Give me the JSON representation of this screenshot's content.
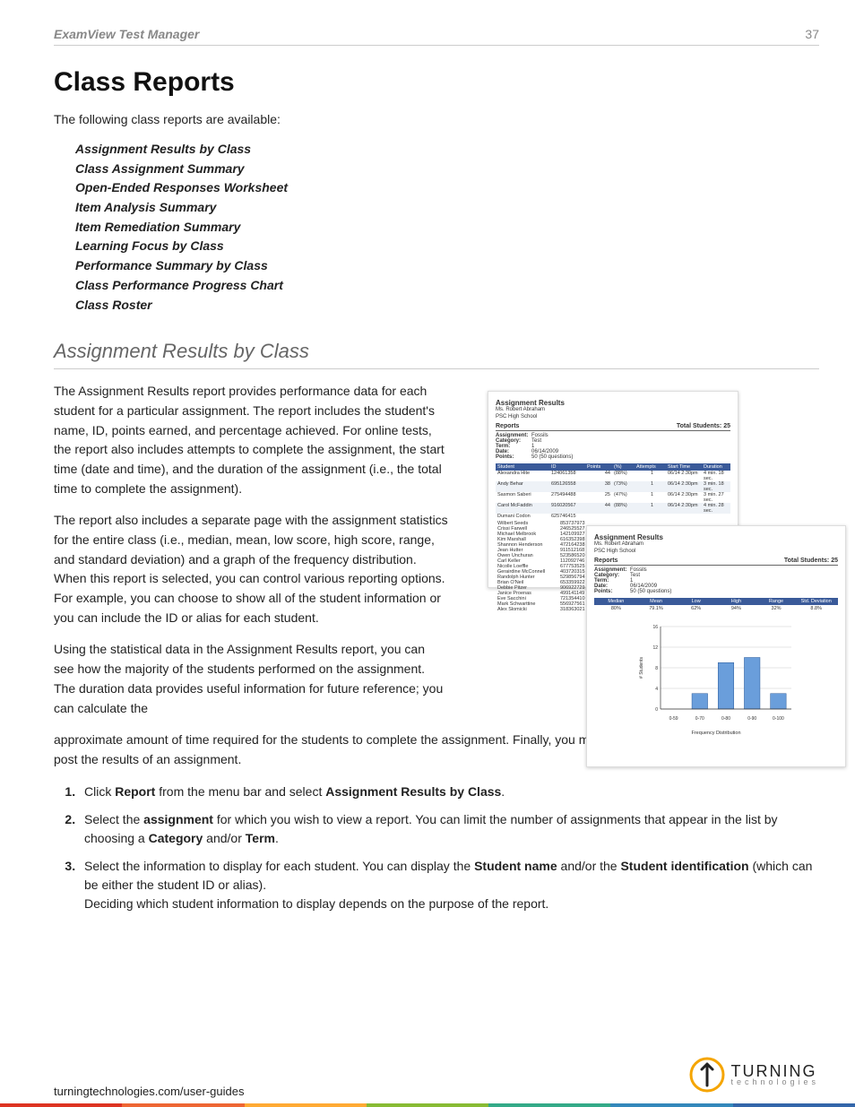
{
  "header": {
    "title": "ExamView Test Manager",
    "page_number": "37"
  },
  "main_title": "Class Reports",
  "intro": "The following class reports are available:",
  "reports": [
    "Assignment Results by Class",
    "Class Assignment Summary",
    "Open-Ended Responses Worksheet",
    "Item Analysis Summary",
    "Item Remediation Summary",
    "Learning Focus by Class",
    "Performance Summary by Class",
    "Class Performance Progress Chart",
    "Class Roster"
  ],
  "section_title": "Assignment Results by Class",
  "p1": "The Assignment Results report provides performance data for each student for a particular assignment. The report includes the student's name, ID, points earned, and percentage achieved. For online tests, the report also includes attempts to complete the assignment, the start time (date and time), and the duration of the assignment (i.e., the total time to complete the assignment).",
  "p2": "The report also includes a separate page with the assignment statistics for the entire class (i.e., median, mean, low score, high score, range, and standard deviation) and a graph of the frequency distribution. When this report is selected, you can control various reporting options. For example, you can choose to show all of the student information or you can include the ID or alias for each student.",
  "p3": "Using the statistical data in the Assignment Results report, you can see how the majority of the students performed on the assignment. The duration data provides useful information for future reference; you can calculate the",
  "p4": "approximate amount of time required for the students to complete the assignment. Finally, you might use the Assignment Results report to post the results of an assignment.",
  "steps": {
    "s1a": "Click ",
    "s1b": "Report",
    "s1c": " from the menu bar and select ",
    "s1d": "Assignment Results by Class",
    "s1e": ".",
    "s2a": "Select the ",
    "s2b": "assignment",
    "s2c": " for which you wish to view a report. You can limit the number of assignments that appear in the list by choosing a ",
    "s2d": "Category",
    "s2e": " and/or ",
    "s2f": "Term",
    "s2g": ".",
    "s3a": "Select the information to display for each student. You can display the ",
    "s3b": "Student name",
    "s3c": " and/or the ",
    "s3d": "Student identification",
    "s3e": " (which can be either the student ID or alias).",
    "s3f": "Deciding which student information to display depends on the purpose of the report."
  },
  "figure": {
    "doc_title": "Assignment Results",
    "teacher": "Ms. Robert Abraham",
    "school": "PSC High School",
    "reports_label": "Reports",
    "total_students_label": "Total Students:",
    "total_students_value": "25",
    "meta": {
      "assignment_label": "Assignment:",
      "assignment_value": "Fossils",
      "category_label": "Category:",
      "category_value": "Test",
      "term_label": "Term:",
      "term_value": "1",
      "date_label": "Date:",
      "date_value": "06/14/2009",
      "points_label": "Points:",
      "points_value": "50 (50 questions)"
    },
    "table_header": [
      "Student",
      "ID",
      "Points",
      "(%)",
      "Attempts",
      "Start Time",
      "Duration"
    ],
    "students": [
      {
        "name": "Alexandra Hite",
        "id": "124061358",
        "pts": "44",
        "pct": "(88%)",
        "att": "1",
        "start": "06/14 2:30pm",
        "dur": "4 min. 18 sec."
      },
      {
        "name": "Andy Behar",
        "id": "695126558",
        "pts": "38",
        "pct": "(73%)",
        "att": "1",
        "start": "06/14 2:30pm",
        "dur": "3 min. 18 sec."
      },
      {
        "name": "Sasmon Saberi",
        "id": "275494488",
        "pts": "25",
        "pct": "(47%)",
        "att": "1",
        "start": "06/14 2:30pm",
        "dur": "3 min. 27 sec."
      },
      {
        "name": "Carol McFaddin",
        "id": "916020567",
        "pts": "44",
        "pct": "(88%)",
        "att": "1",
        "start": "06/14 2:30pm",
        "dur": "4 min. 28 sec."
      },
      {
        "name": "Dumani Codon",
        "id": "625746415",
        "pts": "",
        "pct": "",
        "att": "",
        "start": "",
        "dur": ""
      }
    ],
    "name_id_list": [
      {
        "name": "Wilbert Seeds",
        "id": "853737973"
      },
      {
        "name": "Crissi Farwell",
        "id": "246525527"
      },
      {
        "name": "Michael Melbrook",
        "id": "142109927"
      },
      {
        "name": "Kim Marshall",
        "id": "616352398"
      },
      {
        "name": "Shannon Henderson",
        "id": "472164238"
      },
      {
        "name": "Jean Hutter",
        "id": "911512168"
      },
      {
        "name": "Owen Unchuran",
        "id": "523586520"
      },
      {
        "name": "Carl Keller",
        "id": "112092746"
      },
      {
        "name": "Nicolle Loeffle",
        "id": "677753525"
      },
      {
        "name": "Gerairdine McConnell",
        "id": "403720315"
      },
      {
        "name": "Randolph Hunter",
        "id": "529856794"
      },
      {
        "name": "Brian O'Neil",
        "id": "653359922"
      },
      {
        "name": "Debbie Pitzer",
        "id": "906922729"
      },
      {
        "name": "Janice Proenas",
        "id": "499141149"
      },
      {
        "name": "Eve Sacchini",
        "id": "721354410"
      },
      {
        "name": "Mark Schwarttine",
        "id": "556927561"
      },
      {
        "name": "Alex Slomicki",
        "id": "318363021"
      }
    ],
    "stats_header": [
      "Median",
      "Mean",
      "Low",
      "High",
      "Range",
      "Std. Deviation"
    ],
    "stats_values": [
      "80%",
      "79.1%",
      "62%",
      "94%",
      "32%",
      "8.8%"
    ],
    "chart_caption": "Frequency Distribution"
  },
  "chart_data": {
    "type": "bar",
    "categories": [
      "0-59",
      "0-70",
      "0-80",
      "0-90",
      "0-100"
    ],
    "values": [
      0,
      3,
      9,
      10,
      3
    ],
    "xlabel": "",
    "ylabel": "# Students",
    "ylim": [
      0,
      16
    ],
    "title": "Frequency Distribution"
  },
  "footer": {
    "url": "turningtechnologies.com/user-guides",
    "logo_top": "TURNING",
    "logo_bottom": "technologies"
  }
}
